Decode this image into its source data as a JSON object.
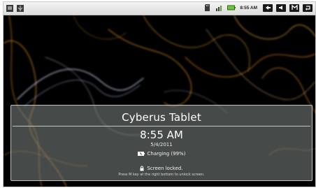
{
  "status_bar": {
    "left_icons": [
      "screenshot-icon",
      "usb-debug-icon"
    ],
    "right_icons": [
      "sd-card-icon",
      "signal-icon",
      "battery-icon"
    ],
    "clock": "8:55 AM",
    "nav_buttons": [
      "back-icon",
      "volume-icon",
      "menu-icon",
      "return-icon"
    ]
  },
  "lock_screen": {
    "device_name": "Cyberus Tablet",
    "time": "8:55 AM",
    "date": "5/4/2011",
    "charging_status": "Charging (99%)",
    "lock_status": "Screen locked.",
    "unlock_hint": "Press M key at the right bottom to unlock screen."
  },
  "colors": {
    "wallpaper_bg": "#000000",
    "status_bar_bg": "#e6e6e6",
    "panel_overlay": "#78807e",
    "text": "#ffffff"
  }
}
